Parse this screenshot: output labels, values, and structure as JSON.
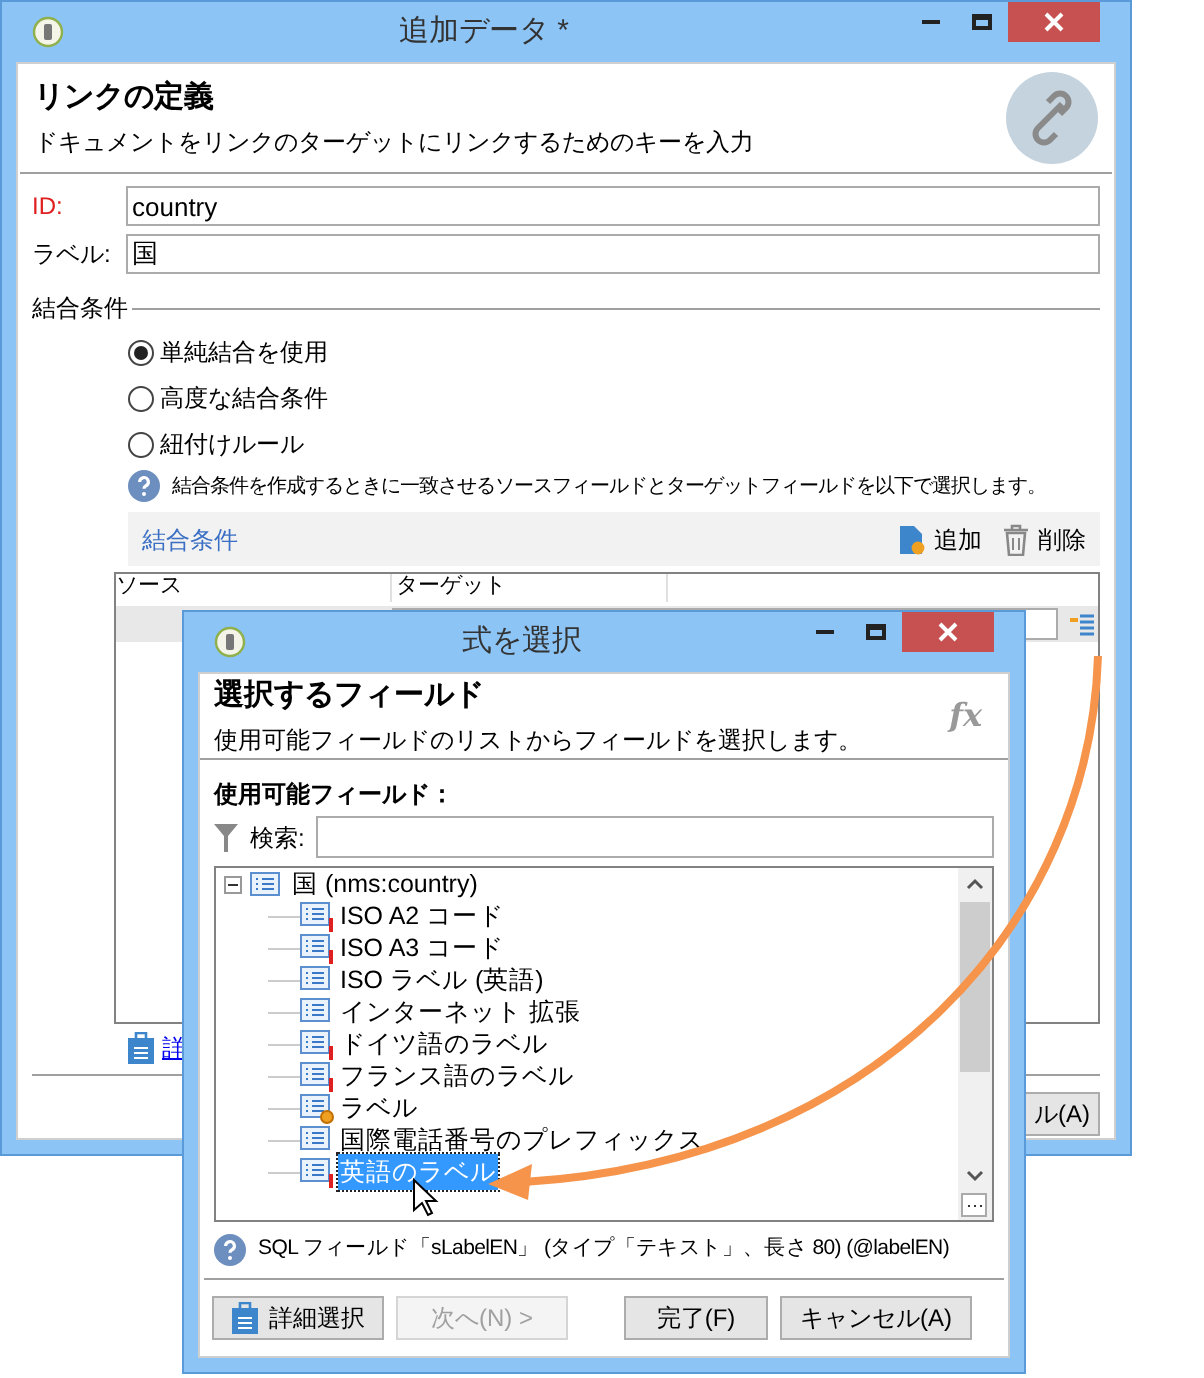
{
  "main_window": {
    "title": "追加データ *",
    "header": {
      "title": "リンクの定義",
      "subtitle": "ドキュメントをリンクのターゲットにリンクするためのキーを入力"
    },
    "fields": [
      {
        "label": "ID:",
        "value": "country",
        "required": true
      },
      {
        "label": "ラベル:",
        "value": "国",
        "required": false
      }
    ],
    "join_section": {
      "title": "結合条件",
      "options": [
        {
          "label": "単純結合を使用",
          "selected": true
        },
        {
          "label": "高度な結合条件",
          "selected": false
        },
        {
          "label": "紐付けルール",
          "selected": false
        }
      ],
      "help": "結合条件を作成するときに一致させるソースフィールドとターゲットフィールドを以下で選択します。",
      "toolbar": {
        "title": "結合条件",
        "actions": [
          {
            "label": "追加",
            "kind": "add"
          },
          {
            "label": "削除",
            "kind": "delete"
          }
        ]
      },
      "table": {
        "columns": [
          "ソース",
          "ターゲット"
        ]
      },
      "details_link": "詳",
      "cancel_button": "ル(A)"
    }
  },
  "dialog": {
    "title": "式を選択",
    "header": {
      "title": "選択するフィールド",
      "subtitle": "使用可能フィールドのリストからフィールドを選択します。",
      "badge": "fx"
    },
    "list_label": "使用可能フィールド：",
    "search": {
      "label": "検索:"
    },
    "tree": {
      "label": "国 (nms:country)",
      "expanded": true,
      "children": [
        {
          "label": "ISO A2 コード",
          "kind": "required",
          "selected": false
        },
        {
          "label": "ISO A3 コード",
          "kind": "required",
          "selected": false
        },
        {
          "label": "ISO ラベル (英語)",
          "kind": "plain",
          "selected": false
        },
        {
          "label": "インターネット 拡張",
          "kind": "plain",
          "selected": false
        },
        {
          "label": "ドイツ語のラベル",
          "kind": "required",
          "selected": false
        },
        {
          "label": "フランス語のラベル",
          "kind": "required",
          "selected": false
        },
        {
          "label": "ラベル",
          "kind": "computed",
          "selected": false
        },
        {
          "label": "国際電話番号のプレフィックス",
          "kind": "plain",
          "selected": false
        },
        {
          "label": "英語のラベル",
          "kind": "required",
          "selected": true
        }
      ]
    },
    "status": "SQL フィールド「sLabelEN」 (タイプ「テキスト」、長さ 80) (@labelEN)",
    "buttons": [
      {
        "label": "詳細選択",
        "kind": "details",
        "disabled": false
      },
      {
        "label": "次へ(N) >",
        "kind": "plain",
        "disabled": true
      },
      {
        "label": "完了(F)",
        "kind": "plain",
        "disabled": false
      },
      {
        "label": "キャンセル(A)",
        "kind": "plain",
        "disabled": false
      }
    ]
  }
}
